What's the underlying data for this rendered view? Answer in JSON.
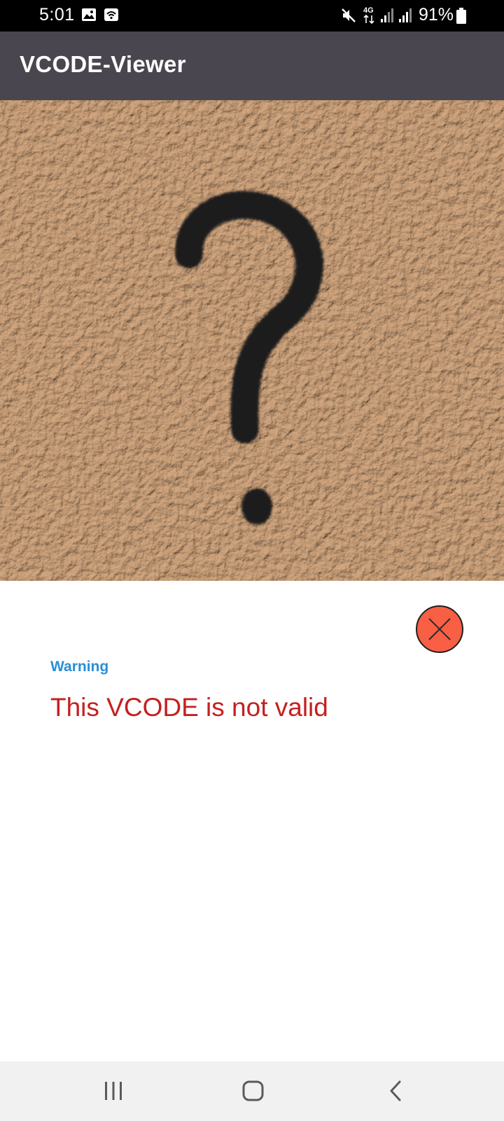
{
  "status_bar": {
    "time": "5:01",
    "network_type": "4G",
    "battery_percent": "91%",
    "icons": [
      "gallery-icon",
      "wifi-calling-icon",
      "mute-icon",
      "data-arrows-icon",
      "signal-icon",
      "signal-icon",
      "battery-icon"
    ]
  },
  "app_bar": {
    "title": "VCODE-Viewer"
  },
  "image": {
    "subject": "question-mark-graffiti"
  },
  "dialog": {
    "label": "Warning",
    "message": "This VCODE is not valid",
    "close_icon": "close-icon"
  },
  "colors": {
    "app_bar": "#4a464f",
    "label": "#2a8fd6",
    "message": "#c4201f",
    "close_button": "#f85f44",
    "image_background": "#cfa580"
  },
  "nav_bar": {
    "buttons": [
      "recents-icon",
      "home-icon",
      "back-icon"
    ]
  }
}
